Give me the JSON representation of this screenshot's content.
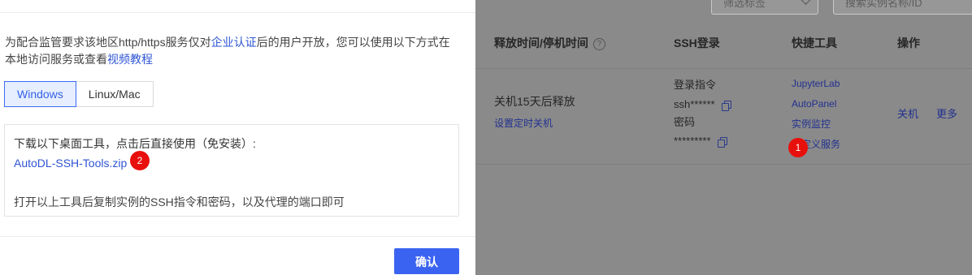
{
  "background": {
    "filter_select_placeholder": "筛选标签",
    "search_placeholder": "搜索实例名称/ID",
    "columns": {
      "release_time": "释放时间/停机时间",
      "ssh_login": "SSH登录",
      "quick_tools": "快捷工具",
      "actions": "操作"
    },
    "row": {
      "release_status": "关机15天后释放",
      "schedule_shutdown": "设置定时关机",
      "login_cmd_label": "登录指令",
      "login_cmd_value": "ssh******",
      "password_label": "密码",
      "password_value": "*********",
      "tools": [
        "JupyterLab",
        "AutoPanel",
        "实例监控",
        "自定义服务"
      ],
      "action_shutdown": "关机",
      "action_more": "更多"
    },
    "badge_1": "1"
  },
  "modal": {
    "notice_part1": "为配合监管要求该地区http/https服务仅对",
    "notice_link_cert": "企业认证",
    "notice_part2": "后的用户开放，您可以使用以下方式在本地访问服务或查看",
    "notice_link_video": "视频教程",
    "tabs": [
      "Windows",
      "Linux/Mac"
    ],
    "active_tab": "Windows",
    "download_text": "下载以下桌面工具，点击后直接使用（免安装）:",
    "download_link": "AutoDL-SSH-Tools.zip",
    "badge_2": "2",
    "instructions": "打开以上工具后复制实例的SSH指令和密码，以及代理的端口即可",
    "confirm_label": "确认"
  },
  "colors": {
    "accent": "#3b63f1",
    "link": "#2f55d4",
    "badge": "#e8100c",
    "overlay": "#8a8a8a"
  }
}
